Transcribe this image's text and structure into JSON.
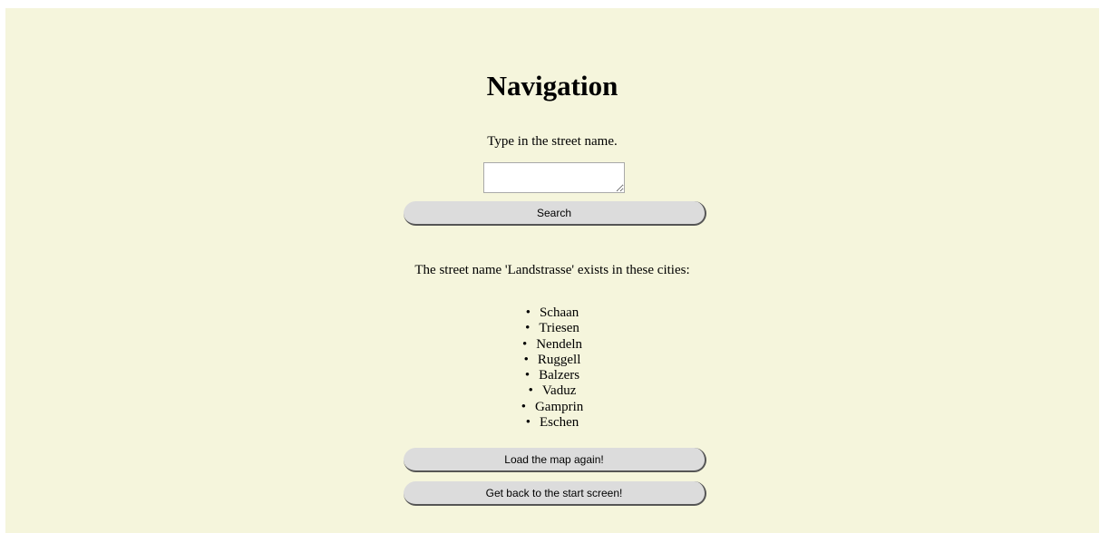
{
  "header": {
    "title": "Navigation"
  },
  "search": {
    "instruction": "Type in the street name.",
    "input_value": "",
    "button_label": "Search"
  },
  "results": {
    "summary": "The street name 'Landstrasse' exists in these cities:",
    "cities": [
      "Schaan",
      "Triesen",
      "Nendeln",
      "Ruggell",
      "Balzers",
      "Vaduz",
      "Gamprin",
      "Eschen"
    ]
  },
  "actions": {
    "reload_label": "Load the map again!",
    "back_label": "Get back to the start screen!"
  },
  "colors": {
    "background": "#f5f5dc",
    "button_background": "#dcdcdc",
    "button_shadow": "#555555"
  }
}
